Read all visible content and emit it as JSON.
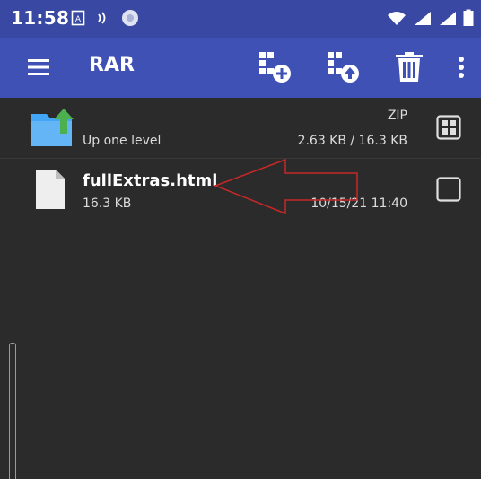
{
  "status": {
    "time": "11:58",
    "icons": [
      "keyboard-icon",
      "nfc-icon",
      "media-icon",
      "wifi-icon",
      "signal-icon",
      "signal-icon-2",
      "battery-icon"
    ]
  },
  "toolbar": {
    "title": "RAR",
    "actions": [
      "add-archive-icon",
      "extract-archive-icon",
      "delete-icon",
      "more-options-icon"
    ]
  },
  "files": [
    {
      "name": "",
      "sub": "Up one level",
      "right_top": "ZIP",
      "right_bottom": "2.63 KB / 16.3 KB",
      "icon": "folder-up-icon"
    },
    {
      "name": "fullExtras.html",
      "sub": "16.3 KB",
      "right_top": "",
      "right_bottom": "10/15/21 11:40",
      "icon": "file-icon"
    }
  ],
  "colors": {
    "appbar": "#3f51b5",
    "statusbar": "#3949a3",
    "background": "#2b2b2b",
    "annotation": "#c62828"
  }
}
